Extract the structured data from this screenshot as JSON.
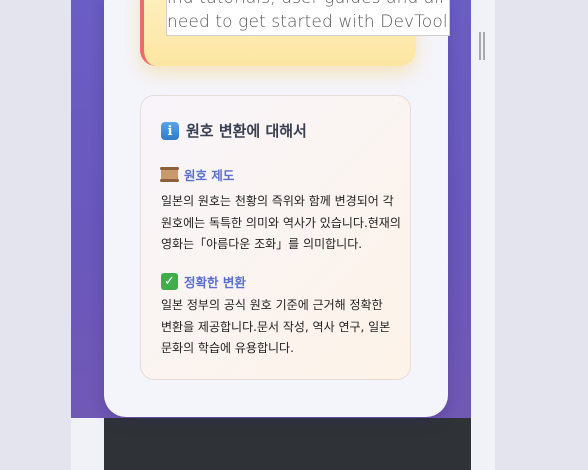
{
  "tooltip": {
    "line1": "ind tutorials, user guides and all c",
    "line2": "need to get started with DevTools"
  },
  "about": {
    "icon": "info-icon",
    "title": "원호 변환에 대해서",
    "sections": [
      {
        "icon": "scroll-icon",
        "heading": "원호 제도",
        "body": "일본의 원호는 천황의 즉위와 함께 변경되어 각 원호에는 독특한 의미와 역사가 있습니다.현재의 영화는「아름다운 조화」를 의미합니다."
      },
      {
        "icon": "check-mark-icon",
        "heading": "정확한 변환",
        "body": "일본 정부의 공식 원호 기준에 근거해 정확한 변환을 제공합니다.문서 작성, 역사 연구, 일본 문화의 학습에 유용합니다."
      }
    ]
  },
  "colors": {
    "gradient": "#6a5dc4",
    "card": "#f4f4fb",
    "warning_bg": "#fde6a2",
    "warning_border": "#ef6b6b",
    "section_heading": "#5b6fd0",
    "footer": "#2f3338"
  }
}
